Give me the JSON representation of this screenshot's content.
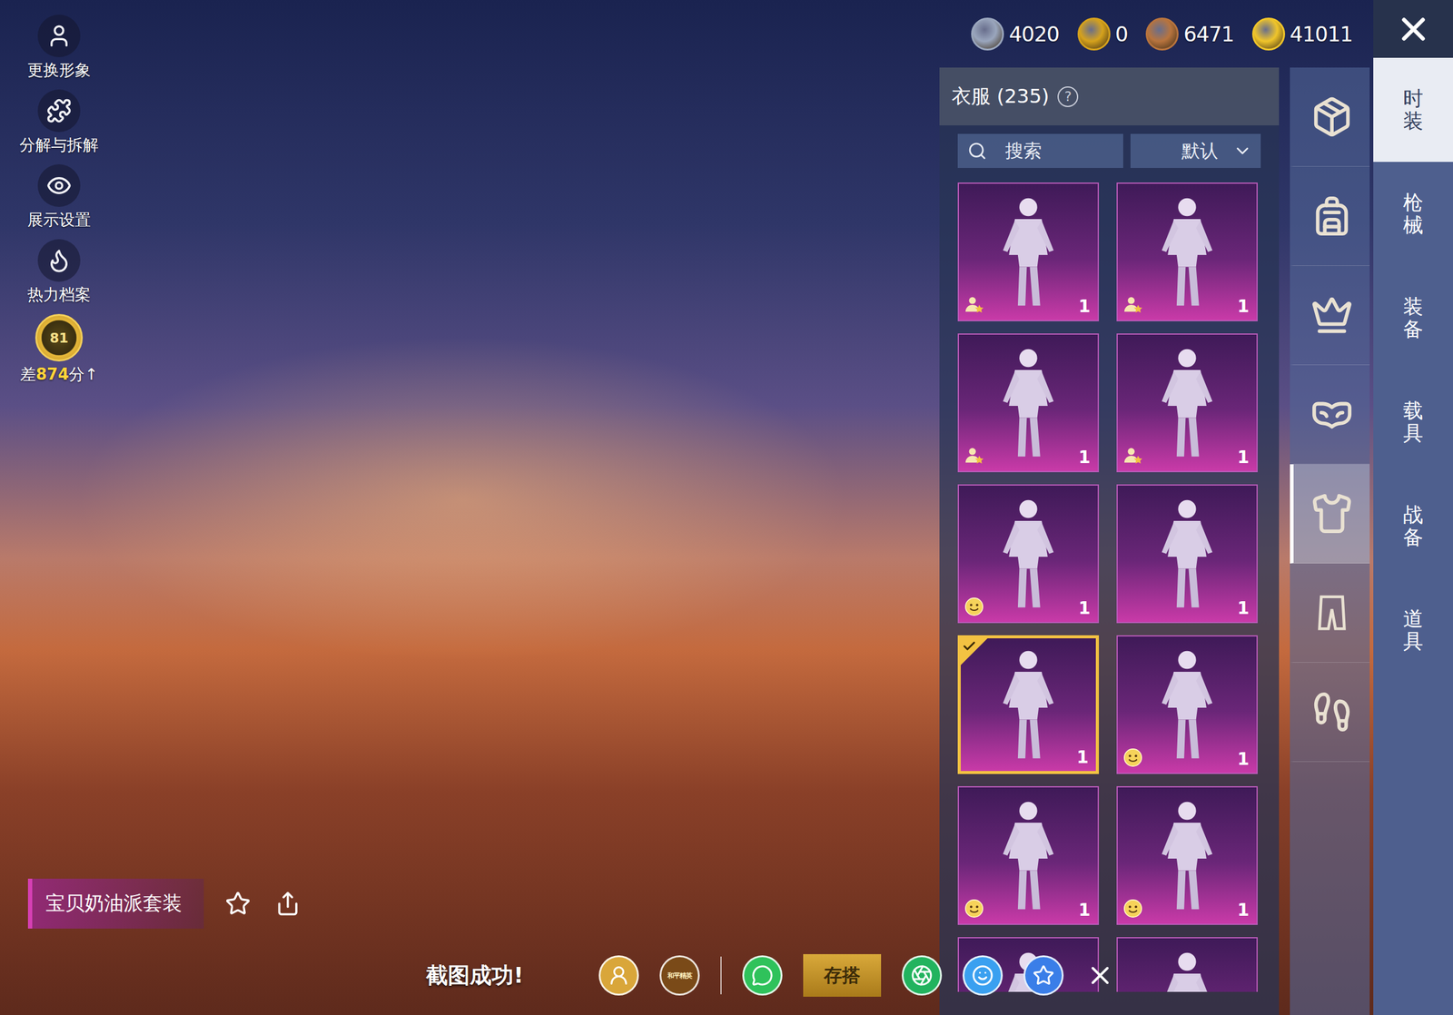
{
  "left_menu": [
    {
      "label": "更换形象"
    },
    {
      "label": "分解与拆解"
    },
    {
      "label": "展示设置"
    },
    {
      "label": "热力档案"
    }
  ],
  "rank": {
    "level": "81",
    "prefix": "差",
    "points": "874",
    "suffix": "分",
    "arrow": "↑"
  },
  "currencies": [
    {
      "amount": "4020",
      "color": "#9aa6bd"
    },
    {
      "amount": "0",
      "color": "#d6a21c"
    },
    {
      "amount": "6471",
      "color": "#b8743e"
    },
    {
      "amount": "41011",
      "color": "#f0c52a"
    }
  ],
  "panel": {
    "title": "衣服",
    "count": "(235)",
    "help": "?",
    "search_placeholder": "搜索",
    "sort": "默认"
  },
  "items": [
    {
      "badge": "star",
      "count": "1",
      "selected": false
    },
    {
      "badge": "star",
      "count": "1",
      "selected": false
    },
    {
      "badge": "star",
      "count": "1",
      "selected": false
    },
    {
      "badge": "star",
      "count": "1",
      "selected": false
    },
    {
      "badge": "smile",
      "count": "1",
      "selected": false
    },
    {
      "badge": "none",
      "count": "1",
      "selected": false
    },
    {
      "badge": "none",
      "count": "1",
      "selected": true
    },
    {
      "badge": "smile",
      "count": "1",
      "selected": false
    },
    {
      "badge": "smile",
      "count": "1",
      "selected": false
    },
    {
      "badge": "smile",
      "count": "1",
      "selected": false
    },
    {
      "badge": "none",
      "selected": false
    },
    {
      "badge": "none",
      "selected": false
    }
  ],
  "categories": [
    {
      "selected": false
    },
    {
      "selected": false
    },
    {
      "selected": false
    },
    {
      "selected": false
    },
    {
      "selected": true
    },
    {
      "selected": false
    },
    {
      "selected": false
    }
  ],
  "tabs": [
    {
      "label": "时装",
      "selected": true
    },
    {
      "label": "枪械",
      "selected": false
    },
    {
      "label": "装备",
      "selected": false
    },
    {
      "label": "载具",
      "selected": false
    },
    {
      "label": "战备",
      "selected": false
    },
    {
      "label": "道具",
      "selected": false
    }
  ],
  "suit": {
    "name": "宝贝奶油派套装"
  },
  "toast": {
    "message": "截图成功!",
    "logo": "和平精英",
    "save_button": "存搭"
  }
}
